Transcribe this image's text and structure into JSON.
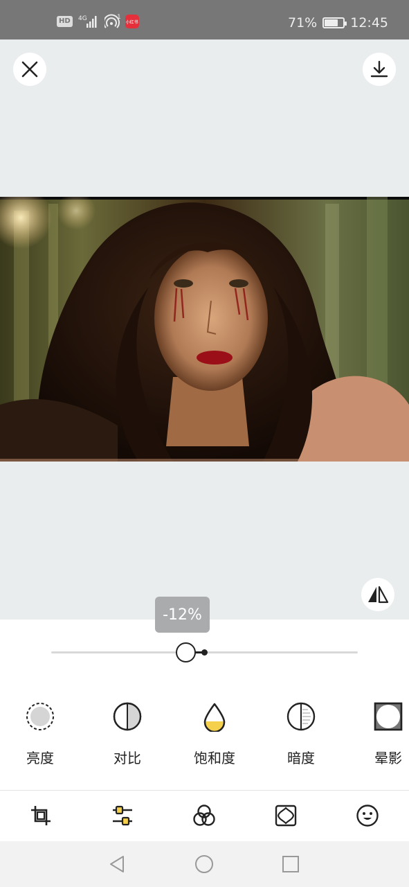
{
  "status_bar": {
    "hd": "HD",
    "network": "4G",
    "hotspot_count": "1",
    "app_badge": "小红书",
    "battery_percent": "71%",
    "battery_level": 0.71,
    "time": "12:45"
  },
  "top_bar": {
    "close_icon": "close-icon",
    "download_icon": "download-icon"
  },
  "compare_icon": "compare-icon",
  "slider": {
    "value_label": "-12%",
    "value": -12
  },
  "tools": [
    {
      "label": "亮度",
      "icon": "brightness-icon"
    },
    {
      "label": "对比",
      "icon": "contrast-icon"
    },
    {
      "label": "饱和度",
      "icon": "saturation-icon"
    },
    {
      "label": "暗度",
      "icon": "shadow-icon"
    },
    {
      "label": "晕影",
      "icon": "vignette-icon"
    }
  ],
  "tabs": [
    "crop-icon",
    "adjust-icon",
    "filter-icon",
    "frame-icon",
    "sticker-icon"
  ],
  "nav": [
    "back-icon",
    "home-icon",
    "recents-icon"
  ],
  "colors": {
    "accent_yellow": "#f5d04c",
    "canvas_bg": "#e9edee",
    "tooltip_bg": "#a9abac"
  }
}
